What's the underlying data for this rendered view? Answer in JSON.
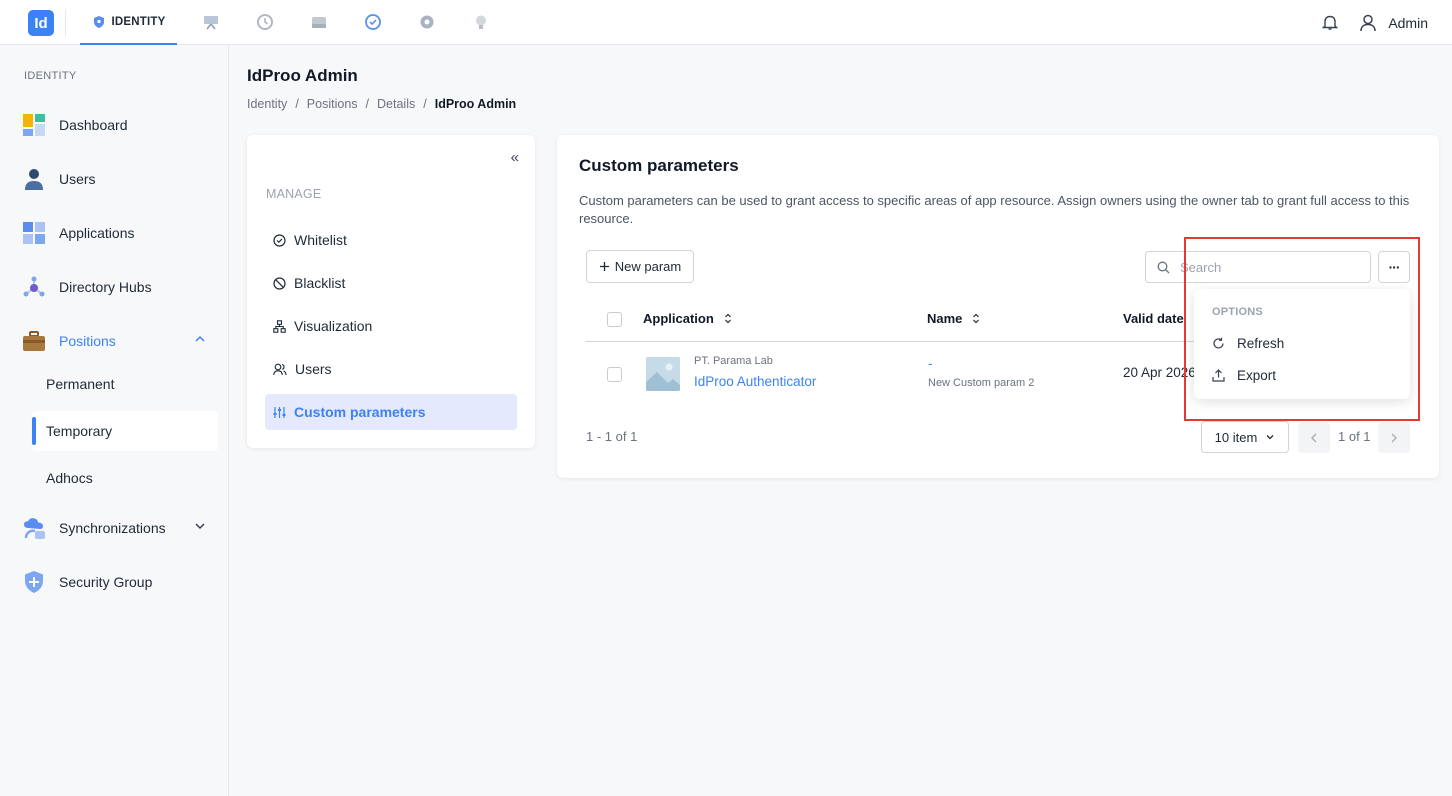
{
  "topbar": {
    "logo_text": "Id",
    "active_module": "IDENTITY",
    "module_icons": [
      "dashboard-module-icon",
      "history-module-icon",
      "storage-module-icon",
      "check-module-icon",
      "settings-module-icon",
      "lightbulb-module-icon"
    ],
    "user_name": "Admin"
  },
  "sidebar": {
    "section": "IDENTITY",
    "items": [
      {
        "label": "Dashboard",
        "icon": "dashboard-icon"
      },
      {
        "label": "Users",
        "icon": "user-icon"
      },
      {
        "label": "Applications",
        "icon": "apps-grid-icon"
      },
      {
        "label": "Directory Hubs",
        "icon": "hub-icon"
      },
      {
        "label": "Positions",
        "icon": "briefcase-icon",
        "expanded": true
      },
      {
        "label": "Synchronizations",
        "icon": "cloud-sync-icon"
      },
      {
        "label": "Security Group",
        "icon": "shield-icon"
      }
    ],
    "positions_sub": [
      "Permanent",
      "Temporary",
      "Adhocs"
    ],
    "selected_sub": "Temporary"
  },
  "page": {
    "title": "IdProo Admin",
    "breadcrumb": [
      "Identity",
      "Positions",
      "Details",
      "IdProo Admin"
    ]
  },
  "manage": {
    "collapse_glyph": "«",
    "label": "MANAGE",
    "items": [
      {
        "label": "Whitelist",
        "icon": "check-circle-icon"
      },
      {
        "label": "Blacklist",
        "icon": "ban-icon"
      },
      {
        "label": "Visualization",
        "icon": "hierarchy-icon"
      },
      {
        "label": "Users",
        "icon": "users-icon"
      },
      {
        "label": "Custom parameters",
        "icon": "sliders-icon",
        "active": true
      }
    ]
  },
  "main": {
    "title": "Custom parameters",
    "description": "Custom parameters can be used to grant access to specific areas of app resource. Assign owners using the owner tab to grant full access to this resource.",
    "new_button": "New param",
    "search_placeholder": "Search",
    "more_glyph": "···",
    "columns": [
      "Application",
      "Name",
      "Valid date"
    ],
    "rows": [
      {
        "app_org": "PT. Parama Lab",
        "app_name": "IdProo Authenticator",
        "name": "-",
        "name_sub": "New Custom param 2",
        "valid_date": "20 Apr 2026"
      }
    ],
    "pagination": {
      "summary": "1 - 1 of 1",
      "page_size": "10 item",
      "page_of": "1 of 1"
    }
  },
  "options_menu": {
    "label": "OPTIONS",
    "items": [
      {
        "label": "Refresh",
        "icon": "refresh-icon"
      },
      {
        "label": "Export",
        "icon": "export-icon"
      }
    ]
  },
  "colors": {
    "accent": "#3b82f6",
    "highlight": "#e53935"
  }
}
